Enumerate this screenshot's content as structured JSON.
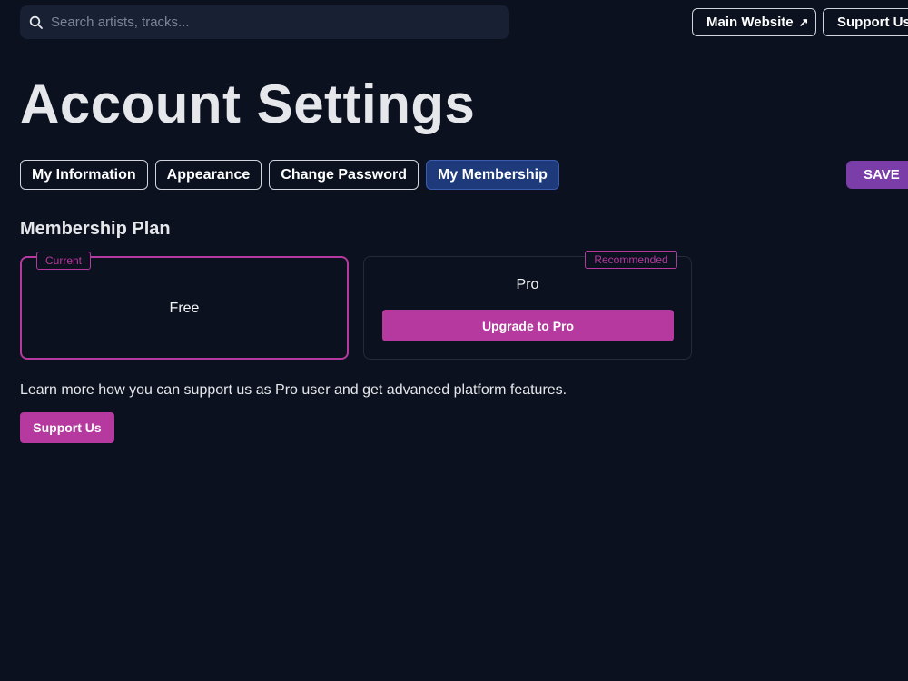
{
  "search": {
    "placeholder": "Search artists, tracks...",
    "icon": "search-icon"
  },
  "header": {
    "main_website_label": "Main Website",
    "main_website_icon": "external-link-icon",
    "support_label": "Support Us"
  },
  "page": {
    "title": "Account Settings"
  },
  "tabs": [
    {
      "label": "My Information",
      "active": false
    },
    {
      "label": "Appearance",
      "active": false
    },
    {
      "label": "Change Password",
      "active": false
    },
    {
      "label": "My Membership",
      "active": true
    }
  ],
  "toolbar": {
    "save_label": "SAVE"
  },
  "membership": {
    "section_title": "Membership Plan",
    "plans": [
      {
        "name": "Free",
        "badge": "Current"
      },
      {
        "name": "Pro",
        "badge": "Recommended",
        "button_label": "Upgrade to Pro"
      }
    ],
    "info_text": "Learn more how you can support us as Pro user and get advanced platform features.",
    "support_button_label": "Support Us"
  },
  "colors": {
    "background": "#0b111e",
    "accent": "#b5399f",
    "active_tab": "#1e3a7b",
    "save_button": "#7b3da8"
  }
}
